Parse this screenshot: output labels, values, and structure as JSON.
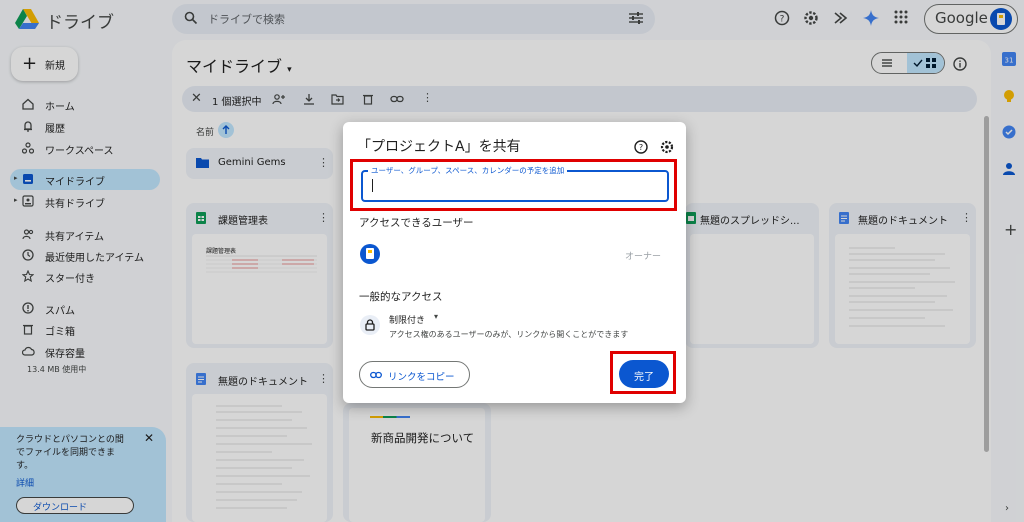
{
  "app": {
    "title": "ドライブ"
  },
  "search": {
    "placeholder": "ドライブで検索"
  },
  "account": {
    "brand": "Google"
  },
  "sidebar": {
    "new_label": "新規",
    "items": [
      {
        "label": "ホーム",
        "icon": "home-icon"
      },
      {
        "label": "履歴",
        "icon": "bell-icon"
      },
      {
        "label": "ワークスペース",
        "icon": "workspace-icon"
      },
      {
        "label": "マイドライブ",
        "icon": "drive-icon"
      },
      {
        "label": "共有ドライブ",
        "icon": "shared-drive-icon"
      },
      {
        "label": "共有アイテム",
        "icon": "people-icon"
      },
      {
        "label": "最近使用したアイテム",
        "icon": "clock-icon"
      },
      {
        "label": "スター付き",
        "icon": "star-icon"
      },
      {
        "label": "スパム",
        "icon": "spam-icon"
      },
      {
        "label": "ゴミ箱",
        "icon": "trash-icon"
      },
      {
        "label": "保存容量",
        "icon": "cloud-icon"
      }
    ],
    "storage_used": "13.4 MB 使用中",
    "promo": {
      "text": "クラウドとパソコンとの間\nでファイルを同期できま\nす。",
      "link": "詳細",
      "button": "ダウンロード"
    }
  },
  "main": {
    "title": "マイドライブ",
    "selection_count": "1 個選択中",
    "column_name": "名前",
    "folder": {
      "name": "Gemini Gems"
    },
    "files": [
      {
        "name": "課題管理表",
        "type": "sheets",
        "thumb_title": "課題管理表"
      },
      {
        "name": "無題のスプレッドシ...",
        "type": "sheets"
      },
      {
        "name": "無題のドキュメント",
        "type": "docs"
      },
      {
        "name": "無題のドキュメント",
        "type": "docs"
      },
      {
        "name": "新商品開発について",
        "type": "slides",
        "thumb_title": "新商品開発について"
      }
    ]
  },
  "dialog": {
    "title": "「プロジェクトA」を共有",
    "input_label": "ユーザー、グループ、スペース、カレンダーの予定を追加",
    "input_value": "",
    "access_heading": "アクセスできるユーザー",
    "owner_role": "オーナー",
    "general_heading": "一般的なアクセス",
    "restriction": "制限付き",
    "restriction_desc": "アクセス権のあるユーザーのみが、リンクから開くことができます",
    "copy_link": "リンクをコピー",
    "done": "完了"
  },
  "colors": {
    "accent": "#0b57d0",
    "selection": "#c2e7ff",
    "highlight": "#e00000"
  }
}
